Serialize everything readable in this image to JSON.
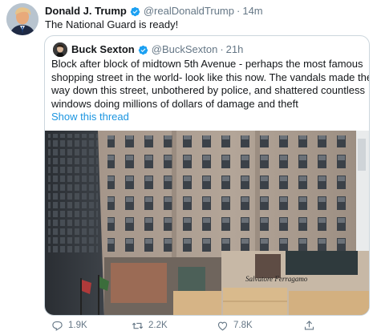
{
  "tweet": {
    "author_name": "Donald J. Trump",
    "handle": "@realDonaldTrump",
    "separator": "·",
    "time": "14m",
    "text": "The National Guard is ready!",
    "avatar_icon": "profile-photo",
    "verified_icon": "verified-badge-icon",
    "verified_color": "#1da1f2"
  },
  "quote": {
    "author_name": "Buck Sexton",
    "handle": "@BuckSexton",
    "separator": "·",
    "time": "21h",
    "text_lines": [
      "Block after block of midtown 5th Avenue - perhaps the most famous",
      "shopping street in the world- look like this now. The vandals made their",
      "way down this street, unbothered by police, and shattered countless",
      "windows doing millions of dollars of damage and theft"
    ],
    "show_thread": "Show this thread",
    "link_color": "#1b95e0",
    "photo_signage": "Salvatore Ferragamo"
  },
  "actions": {
    "reply_count": "1.9K",
    "retweet_count": "2.2K",
    "like_count": "7.8K",
    "icons": [
      "reply-icon",
      "retweet-icon",
      "like-icon",
      "share-icon"
    ]
  }
}
